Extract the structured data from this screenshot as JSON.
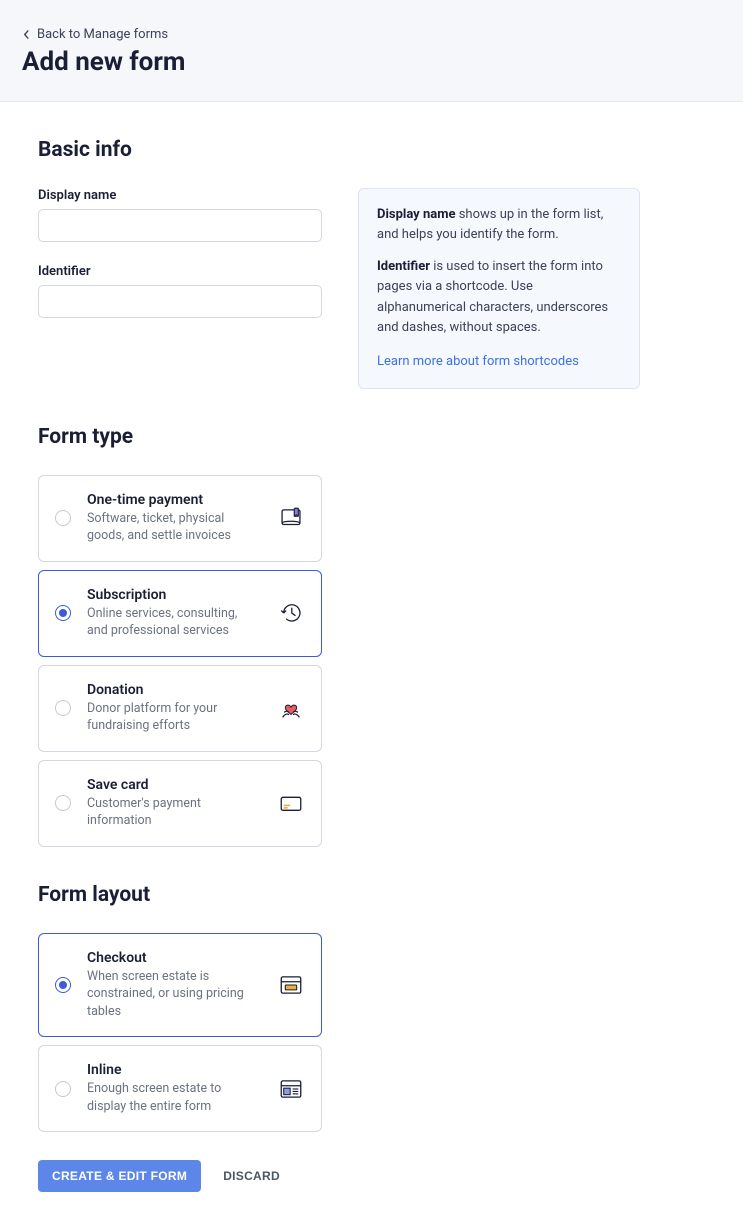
{
  "header": {
    "back_label": "Back to Manage forms",
    "title": "Add new form"
  },
  "basic_info": {
    "section_title": "Basic info",
    "display_name_label": "Display name",
    "display_name_value": "",
    "identifier_label": "Identifier",
    "identifier_value": "",
    "info_display_lead": "Display name",
    "info_display_rest": " shows up in the form list, and helps you identify the form.",
    "info_identifier_lead": "Identifier",
    "info_identifier_rest": " is used to insert the form into pages via a shortcode. Use alphanumerical characters, underscores and dashes, without spaces.",
    "info_link": "Learn more about form shortcodes"
  },
  "form_type": {
    "section_title": "Form type",
    "options": [
      {
        "title": "One-time payment",
        "desc": "Software, ticket, physical goods, and settle invoices",
        "selected": false,
        "icon": "book-icon"
      },
      {
        "title": "Subscription",
        "desc": "Online services, consulting, and professional services",
        "selected": true,
        "icon": "history-icon"
      },
      {
        "title": "Donation",
        "desc": "Donor platform for your fundraising efforts",
        "selected": false,
        "icon": "heart-hands-icon"
      },
      {
        "title": "Save card",
        "desc": "Customer's payment information",
        "selected": false,
        "icon": "card-icon"
      }
    ]
  },
  "form_layout": {
    "section_title": "Form layout",
    "options": [
      {
        "title": "Checkout",
        "desc": "When screen estate is constrained, or using pricing tables",
        "selected": true,
        "icon": "window-icon"
      },
      {
        "title": "Inline",
        "desc": "Enough screen estate to display the entire form",
        "selected": false,
        "icon": "layout-icon"
      }
    ]
  },
  "actions": {
    "primary": "CREATE & EDIT FORM",
    "secondary": "DISCARD"
  }
}
